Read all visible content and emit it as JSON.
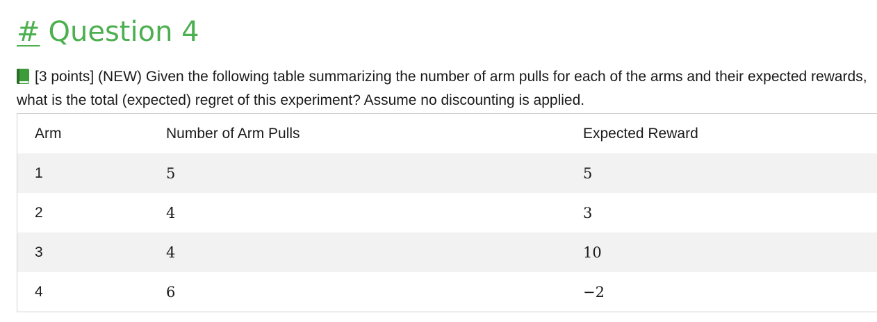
{
  "heading": {
    "hash": "#",
    "title": "Question 4"
  },
  "question": {
    "icon": "green-book-icon",
    "text": "[3 points] (NEW) Given the following table summarizing the number of arm pulls for each of the arms and their expected rewards, what is the total (expected) regret of this experiment? Assume no discounting is applied."
  },
  "table": {
    "headers": [
      "Arm",
      "Number of Arm Pulls",
      "Expected Reward"
    ],
    "rows": [
      [
        "1",
        "5",
        "5"
      ],
      [
        "2",
        "4",
        "3"
      ],
      [
        "3",
        "4",
        "10"
      ],
      [
        "4",
        "6",
        "−2"
      ]
    ]
  },
  "colors": {
    "heading": "#4caf50",
    "stripe": "#f2f2f2",
    "border": "#d0d0d0"
  }
}
